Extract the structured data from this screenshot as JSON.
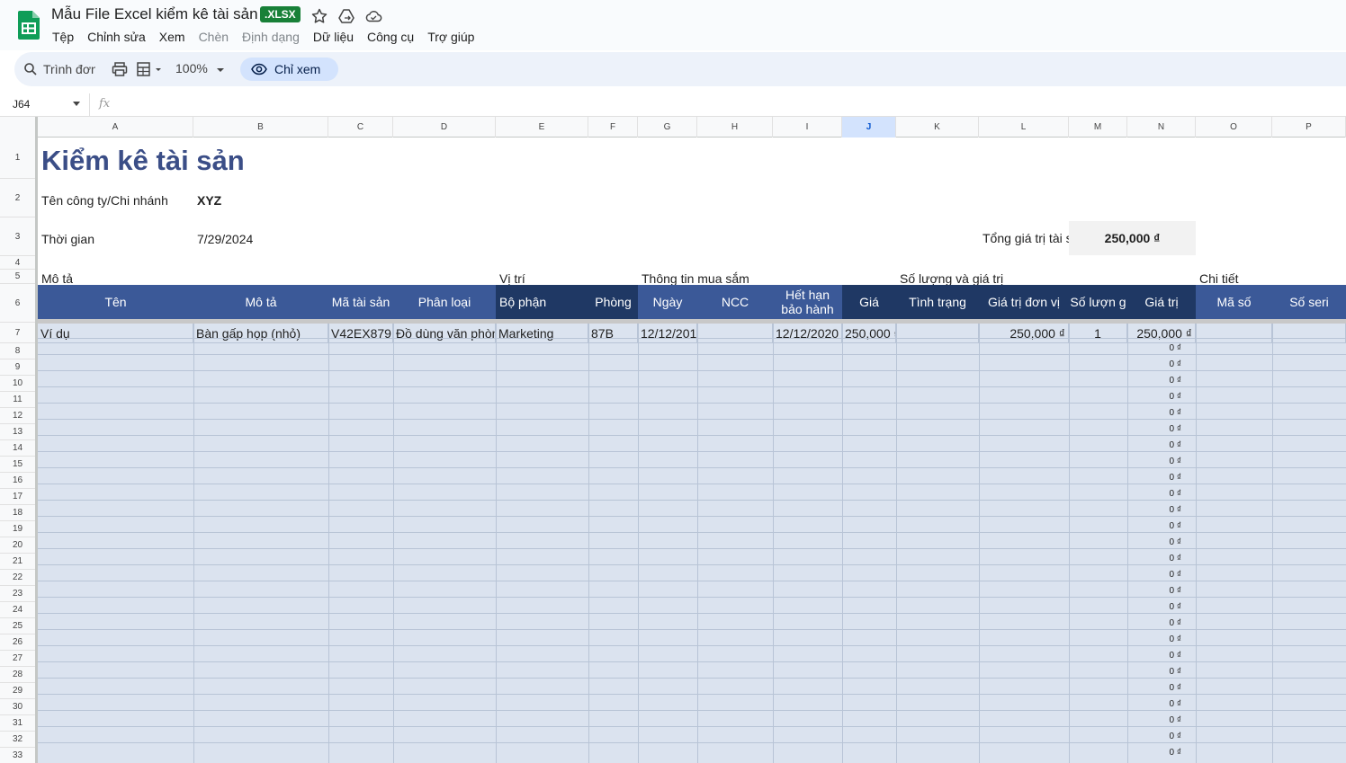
{
  "app": {
    "doc_title": "Mẫu File Excel kiểm kê tài sản",
    "format_badge": ".XLSX",
    "menu": [
      "Tệp",
      "Chỉnh sửa",
      "Xem",
      "Chèn",
      "Định dạng",
      "Dữ liệu",
      "Công cụ",
      "Trợ giúp"
    ],
    "menu_disabled": [
      false,
      false,
      false,
      true,
      true,
      false,
      false,
      false
    ],
    "search_placeholder": "Trình đơn",
    "zoom": "100%",
    "view_mode": "Chỉ xem",
    "name_box": "J64",
    "fx_label": "fx"
  },
  "grid": {
    "columns": [
      "A",
      "B",
      "C",
      "D",
      "E",
      "F",
      "G",
      "H",
      "I",
      "J",
      "K",
      "L",
      "M",
      "N",
      "O",
      "P"
    ],
    "selected_column": "J",
    "row_numbers": [
      "1",
      "2",
      "3",
      "4",
      "5",
      "6",
      "7",
      "8",
      "9",
      "10",
      "11",
      "12",
      "13",
      "14",
      "15",
      "16",
      "17",
      "18",
      "19",
      "20",
      "21",
      "22",
      "23",
      "24",
      "25",
      "26",
      "27",
      "28",
      "29",
      "30",
      "31",
      "32",
      "33"
    ]
  },
  "sheet": {
    "title": "Kiểm kê tài sản",
    "company_label": "Tên công ty/Chi nhánh",
    "company_value": "XYZ",
    "date_label": "Thời gian",
    "date_value": "7/29/2024",
    "total_label": "Tổng giá trị tài s",
    "total_value": "250,000 ₫",
    "groups": {
      "description": "Mô tả",
      "location": "Vị trí",
      "purchase": "Thông tin mua sắm",
      "quantity": "Số lượng và giá trị",
      "detail": "Chi tiết"
    },
    "headers": [
      "Tên",
      "Mô tả",
      "Mã tài sản",
      "Phân loại",
      "Bộ phận",
      "Phòng",
      "Ngày",
      "NCC",
      "Hết hạn\nbảo hành",
      "Giá",
      "Tình trạng",
      "Giá trị đơn vị",
      "Số lượn g",
      "Giá trị",
      "Mã số",
      "Số seri"
    ],
    "example_row": [
      "Ví dụ",
      "Bàn gấp họp (nhỏ)",
      "V42EX879",
      "Đồ dùng văn phòn",
      "Marketing",
      "87B",
      "12/12/201(",
      "",
      "12/12/2020",
      "250,000 ₫",
      "",
      "250,000 ₫",
      "1",
      "250,000 ₫",
      "",
      ""
    ],
    "zero_value": "0 ₫"
  }
}
